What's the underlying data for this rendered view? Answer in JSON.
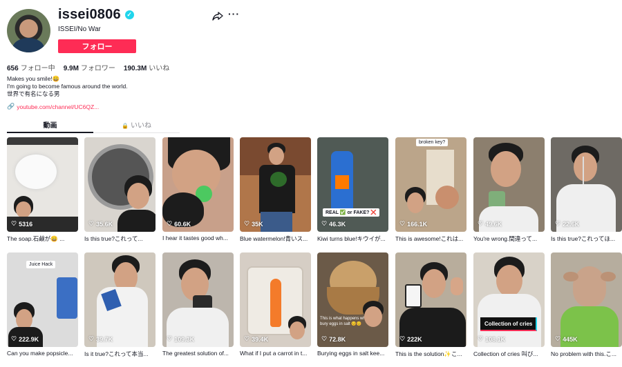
{
  "profile": {
    "username": "issei0806",
    "nickname": "ISSEI/No War",
    "follow_label": "フォロー",
    "verified": true
  },
  "stats": {
    "following_count": "656",
    "following_label": "フォロー中",
    "followers_count": "9.9M",
    "followers_label": "フォロワー",
    "likes_count": "190.3M",
    "likes_label": "いいね"
  },
  "bio": {
    "line1": "Makes you smile!😀",
    "line2": "I'm going to become famous around the world.",
    "line3": "世界で有名になる男",
    "link": "youtube.com/channel/UC6QZ..."
  },
  "tabs": {
    "videos_label": "動画",
    "liked_label": "いいね"
  },
  "icons": {
    "share": "share-icon",
    "more": "more-icon",
    "heart": "heart-outline-icon",
    "lock": "lock-icon",
    "link": "link-icon"
  },
  "colors": {
    "accent": "#fe2c55",
    "verified": "#20d5ec"
  },
  "videos": [
    {
      "views": "5316",
      "caption": "The soap.石鹸が😄 ..."
    },
    {
      "views": "35.6K",
      "caption": "Is this true?これって..."
    },
    {
      "views": "60.6K",
      "caption": "I hear it tastes good wh..."
    },
    {
      "views": "35K",
      "caption": "Blue watermelon!青いス..."
    },
    {
      "views": "46.3K",
      "caption": "Kiwi turns blue!キウイが..."
    },
    {
      "views": "166.1K",
      "caption": "This is awesome!これは..."
    },
    {
      "views": "49.6K",
      "caption": "You're wrong.間違って..."
    },
    {
      "views": "22.6K",
      "caption": "Is this true?これってほ..."
    },
    {
      "views": "222.9K",
      "caption": "Can you make popsicle..."
    },
    {
      "views": "39.7K",
      "caption": "Is it true?これって本当..."
    },
    {
      "views": "109.3K",
      "caption": "The greatest solution of..."
    },
    {
      "views": "39.4K",
      "caption": "What if I put a carrot in t..."
    },
    {
      "views": "72.8K",
      "caption": "Burying eggs in salt kee..."
    },
    {
      "views": "222K",
      "caption": "This is the solution✨こ..."
    },
    {
      "views": "108.1K",
      "caption": "Collection of cries 叫び..."
    },
    {
      "views": "445K",
      "caption": "No problem with this.こ..."
    }
  ],
  "overlays": {
    "v5": "REAL ✅ or FAKE? ❌",
    "v6": "broken key?",
    "v9": "Juice Hack",
    "v13": "This is what happens when you bury eggs in salt 😊😊",
    "v15": "Collection of cries"
  }
}
